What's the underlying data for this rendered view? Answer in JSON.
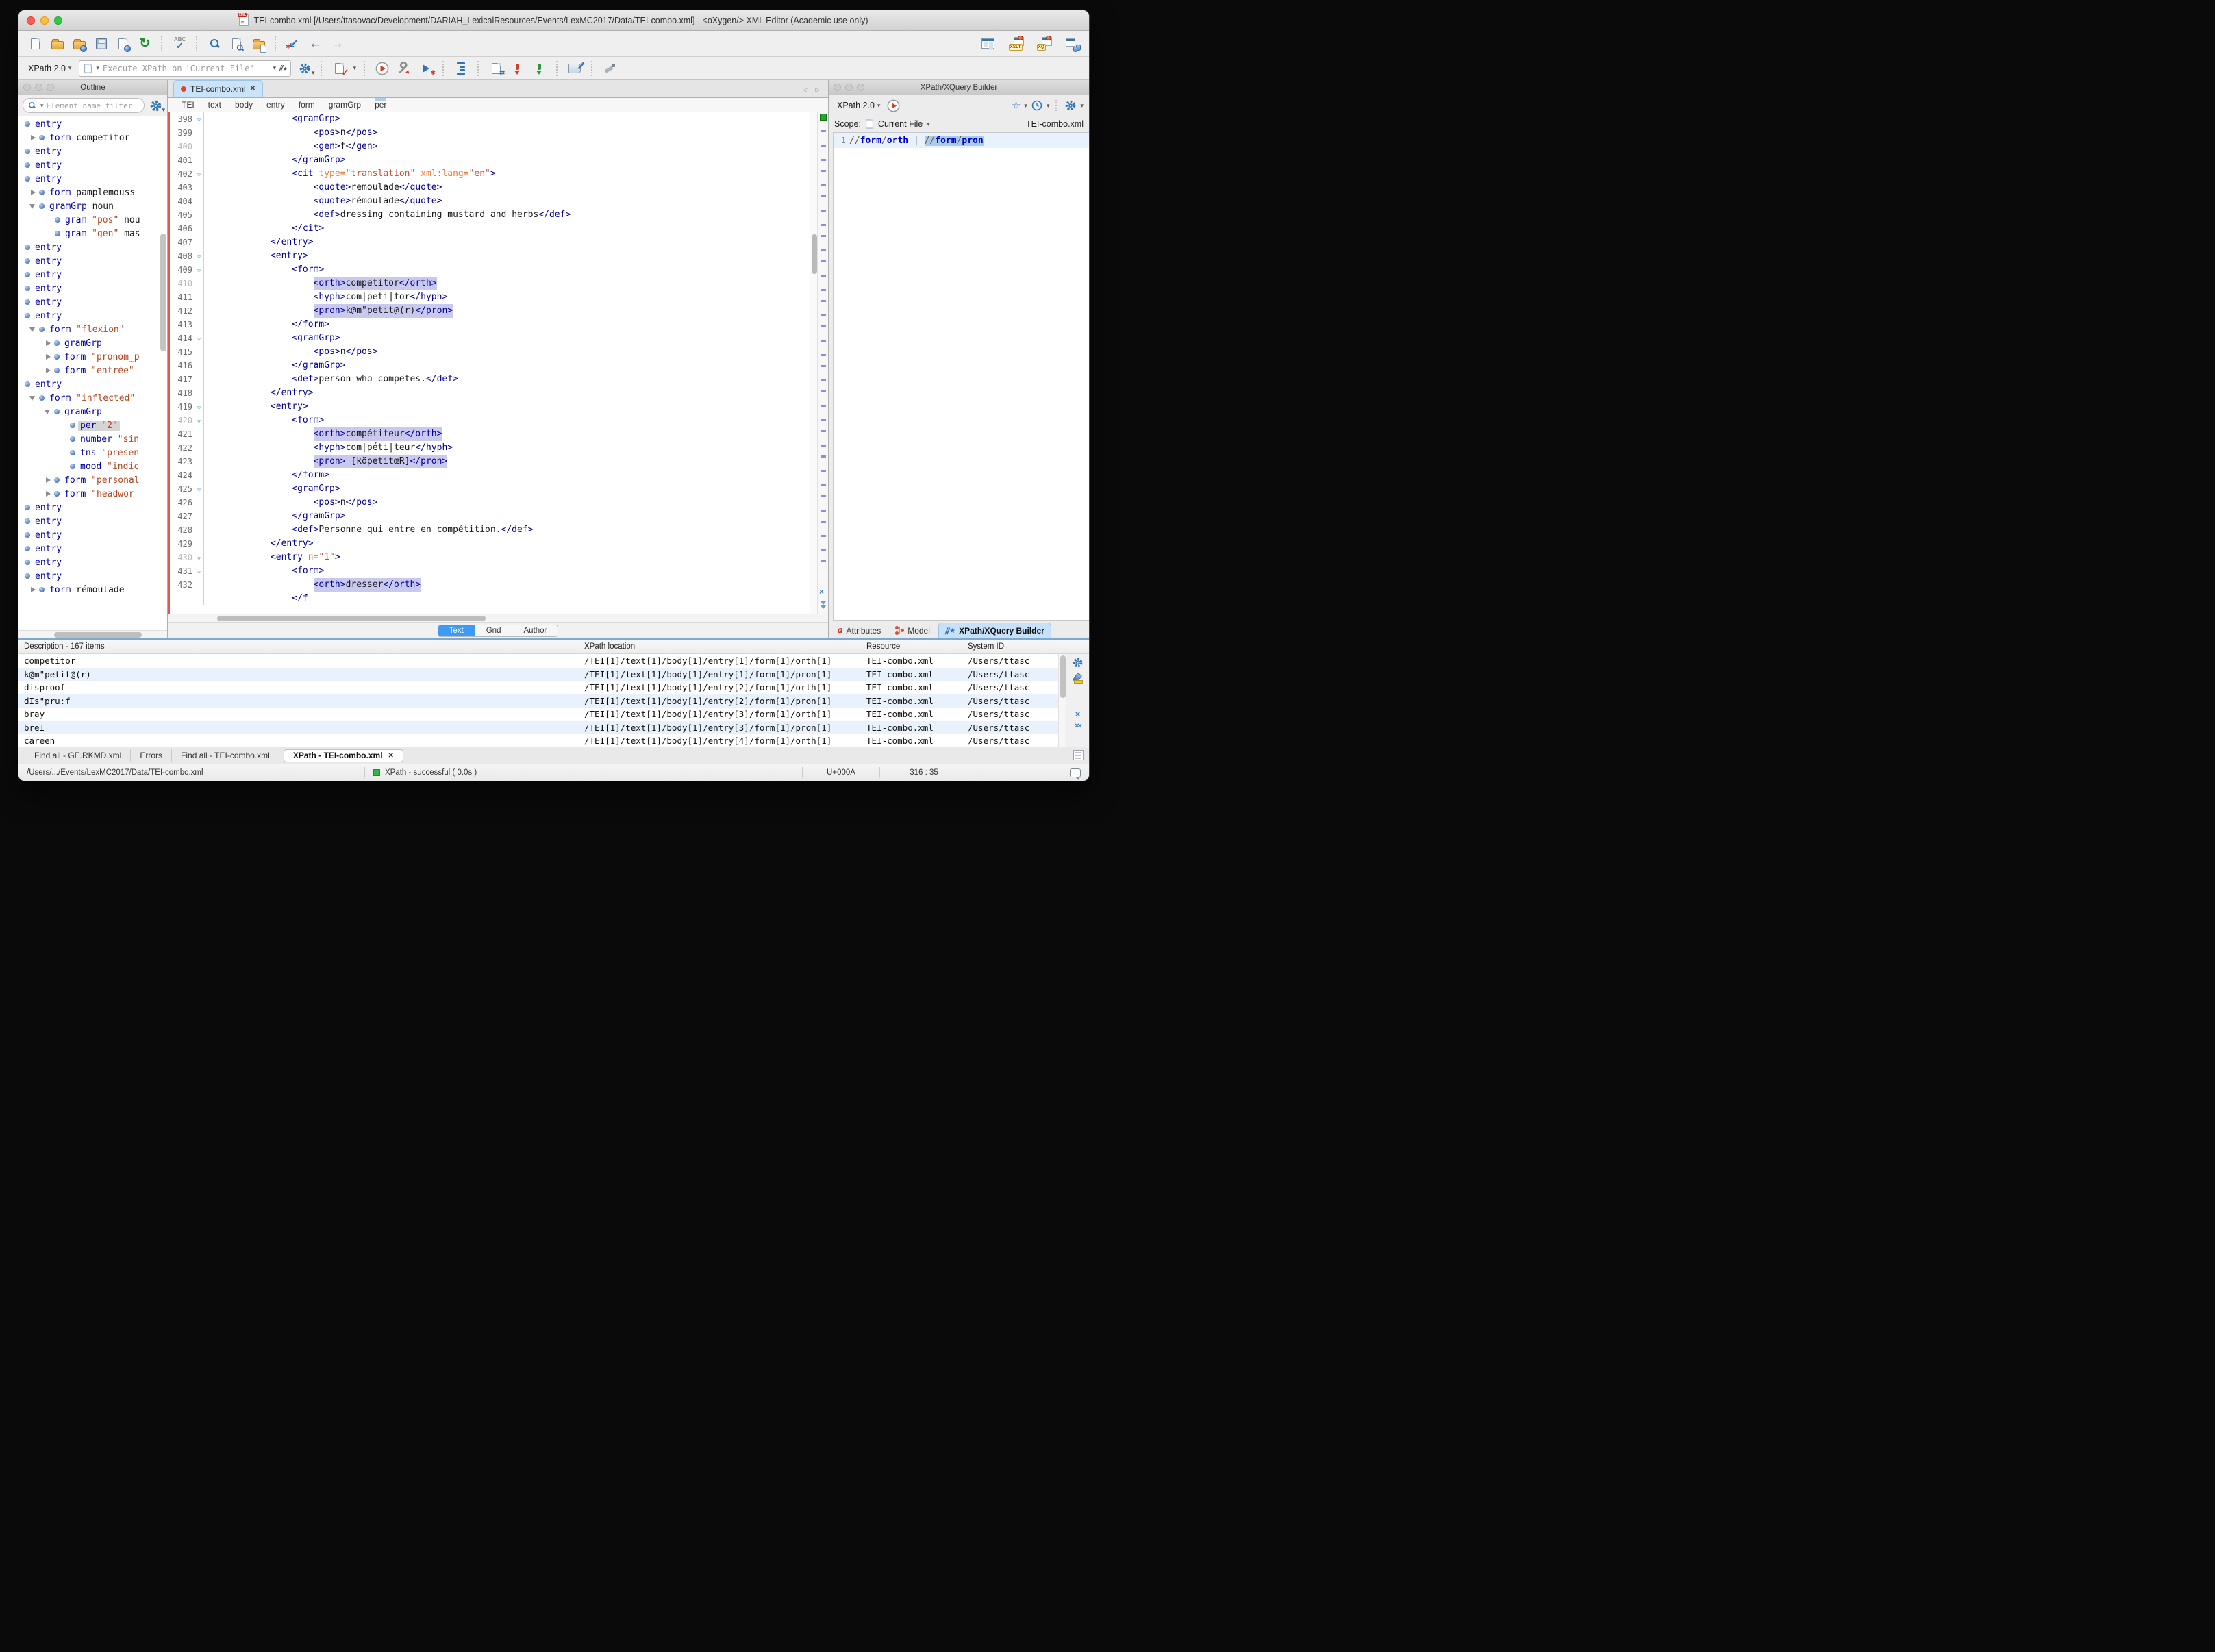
{
  "window": {
    "title": "TEI-combo.xml [/Users/ttasovac/Development/DARIAH_LexicalResources/Events/LexMC2017/Data/TEI-combo.xml] - <oXygen/> XML Editor (Academic use only)"
  },
  "icons": {
    "fold": "▽",
    "reload": "↻",
    "spell_abc": "ABC",
    "check": "✓",
    "last_edit": "↙",
    "asterisk": "✱",
    "back": "←",
    "forward": "→",
    "xslt_badge": "XSLT",
    "xq_badge": "XQ",
    "dropdown": "▾",
    "star": "☆",
    "fav_star": "★",
    "slashes": "//",
    "tab_nav": "◁ ▷",
    "close": "✕",
    "clear": "×",
    "clear_all": "××",
    "attr_a": "a"
  },
  "toolbar_xpath": {
    "engine": "XPath 2.0",
    "execute_label": "Execute XPath on",
    "execute_target": "'Current File'"
  },
  "outline": {
    "title": "Outline",
    "filter_placeholder": "Element name filter",
    "items": [
      {
        "l": 1,
        "n": "entry"
      },
      {
        "l": 2,
        "e": "r",
        "n": "form",
        "t": "competitor"
      },
      {
        "l": 1,
        "n": "entry"
      },
      {
        "l": 1,
        "n": "entry"
      },
      {
        "l": 1,
        "n": "entry"
      },
      {
        "l": 2,
        "e": "r",
        "n": "form",
        "t": "pamplemouss"
      },
      {
        "l": 2,
        "e": "d",
        "n": "gramGrp",
        "t": "noun"
      },
      {
        "l": 3,
        "n": "gram",
        "v": "\"pos\"",
        "t": "nou"
      },
      {
        "l": 3,
        "n": "gram",
        "v": "\"gen\"",
        "t": "mas"
      },
      {
        "l": 1,
        "n": "entry"
      },
      {
        "l": 1,
        "n": "entry"
      },
      {
        "l": 1,
        "n": "entry"
      },
      {
        "l": 1,
        "n": "entry"
      },
      {
        "l": 1,
        "n": "entry"
      },
      {
        "l": 1,
        "n": "entry"
      },
      {
        "l": 2,
        "e": "d",
        "n": "form",
        "v": "\"flexion\""
      },
      {
        "l": 3,
        "e": "r",
        "n": "gramGrp"
      },
      {
        "l": 3,
        "e": "r",
        "n": "form",
        "v": "\"pronom_p"
      },
      {
        "l": 3,
        "e": "r",
        "n": "form",
        "v": "\"entrée\""
      },
      {
        "l": 1,
        "n": "entry"
      },
      {
        "l": 2,
        "e": "d",
        "n": "form",
        "v": "\"inflected\""
      },
      {
        "l": 3,
        "e": "d",
        "n": "gramGrp"
      },
      {
        "l": 4,
        "n": "per",
        "v": "\"2\"",
        "sel": true
      },
      {
        "l": 4,
        "n": "number",
        "v": "\"sin"
      },
      {
        "l": 4,
        "n": "tns",
        "v": "\"presen"
      },
      {
        "l": 4,
        "n": "mood",
        "v": "\"indic"
      },
      {
        "l": 3,
        "e": "r",
        "n": "form",
        "v": "\"personal"
      },
      {
        "l": 3,
        "e": "r",
        "n": "form",
        "v": "\"headwor"
      },
      {
        "l": 1,
        "n": "entry"
      },
      {
        "l": 1,
        "n": "entry"
      },
      {
        "l": 1,
        "n": "entry"
      },
      {
        "l": 1,
        "n": "entry"
      },
      {
        "l": 1,
        "n": "entry"
      },
      {
        "l": 1,
        "n": "entry"
      },
      {
        "l": 2,
        "e": "r",
        "n": "form",
        "t": "rémoulade"
      }
    ]
  },
  "editor": {
    "tab_title": "TEI-combo.xml",
    "breadcrumb": [
      "TEI",
      "text",
      "body",
      "entry",
      "form",
      "gramGrp",
      "per"
    ],
    "modes": [
      "Text",
      "Grid",
      "Author"
    ],
    "active_mode": "Text",
    "lines": [
      {
        "n": "398",
        "fold": true,
        "ind": 16,
        "seg": [
          [
            "g",
            "<gramGrp>"
          ]
        ]
      },
      {
        "n": "399",
        "ind": 20,
        "seg": [
          [
            "g",
            "<pos>"
          ],
          [
            "x",
            "n"
          ],
          [
            "g",
            "</pos>"
          ]
        ]
      },
      {
        "n": "400",
        "dim": true,
        "ind": 20,
        "seg": [
          [
            "g",
            "<gen>"
          ],
          [
            "x",
            "f"
          ],
          [
            "g",
            "</gen>"
          ]
        ]
      },
      {
        "n": "401",
        "ind": 16,
        "seg": [
          [
            "g",
            "</gramGrp>"
          ]
        ]
      },
      {
        "n": "402",
        "fold": true,
        "ind": 16,
        "seg": [
          [
            "g",
            "<cit"
          ],
          [
            "a",
            " type="
          ],
          [
            "v",
            "\"translation\""
          ],
          [
            "a",
            " xml:lang="
          ],
          [
            "v",
            "\"en\""
          ],
          [
            "g",
            ">"
          ]
        ]
      },
      {
        "n": "403",
        "ind": 20,
        "seg": [
          [
            "g",
            "<quote>"
          ],
          [
            "x",
            "remoulade"
          ],
          [
            "g",
            "</quote>"
          ]
        ]
      },
      {
        "n": "404",
        "ind": 20,
        "seg": [
          [
            "g",
            "<quote>"
          ],
          [
            "x",
            "rémoulade"
          ],
          [
            "g",
            "</quote>"
          ]
        ]
      },
      {
        "n": "405",
        "ind": 20,
        "seg": [
          [
            "g",
            "<def>"
          ],
          [
            "x",
            "dressing containing mustard and herbs"
          ],
          [
            "g",
            "</def>"
          ]
        ]
      },
      {
        "n": "406",
        "ind": 16,
        "seg": [
          [
            "g",
            "</cit>"
          ]
        ]
      },
      {
        "n": "407",
        "ind": 12,
        "seg": [
          [
            "g",
            "</entry>"
          ]
        ]
      },
      {
        "n": "408",
        "fold": true,
        "ind": 12,
        "seg": [
          [
            "g",
            "<entry>"
          ]
        ]
      },
      {
        "n": "409",
        "fold": true,
        "ind": 16,
        "seg": [
          [
            "g",
            "<form>"
          ]
        ]
      },
      {
        "n": "410",
        "dim": true,
        "ind": 20,
        "hl": true,
        "seg": [
          [
            "g",
            "<orth>"
          ],
          [
            "x",
            "competitor"
          ],
          [
            "g",
            "</orth>"
          ]
        ]
      },
      {
        "n": "411",
        "ind": 20,
        "seg": [
          [
            "g",
            "<hyph>"
          ],
          [
            "x",
            "com|peti|tor"
          ],
          [
            "g",
            "</hyph>"
          ]
        ]
      },
      {
        "n": "412",
        "ind": 20,
        "hl": true,
        "seg": [
          [
            "g",
            "<pron>"
          ],
          [
            "x",
            "k@m\"petit@(r)"
          ],
          [
            "g",
            "</pron>"
          ]
        ]
      },
      {
        "n": "413",
        "ind": 16,
        "seg": [
          [
            "g",
            "</form>"
          ]
        ]
      },
      {
        "n": "414",
        "fold": true,
        "ind": 16,
        "seg": [
          [
            "g",
            "<gramGrp>"
          ]
        ]
      },
      {
        "n": "415",
        "ind": 20,
        "seg": [
          [
            "g",
            "<pos>"
          ],
          [
            "x",
            "n"
          ],
          [
            "g",
            "</pos>"
          ]
        ]
      },
      {
        "n": "416",
        "ind": 16,
        "seg": [
          [
            "g",
            "</gramGrp>"
          ]
        ]
      },
      {
        "n": "417",
        "ind": 16,
        "seg": [
          [
            "g",
            "<def>"
          ],
          [
            "x",
            "person who competes."
          ],
          [
            "g",
            "</def>"
          ]
        ]
      },
      {
        "n": "418",
        "ind": 12,
        "seg": [
          [
            "g",
            "</entry>"
          ]
        ]
      },
      {
        "n": "419",
        "fold": true,
        "ind": 12,
        "seg": [
          [
            "g",
            "<entry>"
          ]
        ]
      },
      {
        "n": "420",
        "dim": true,
        "fold": true,
        "ind": 16,
        "seg": [
          [
            "g",
            "<form>"
          ]
        ]
      },
      {
        "n": "421",
        "ind": 20,
        "hl": true,
        "seg": [
          [
            "g",
            "<orth>"
          ],
          [
            "x",
            "compétiteur"
          ],
          [
            "g",
            "</orth>"
          ]
        ]
      },
      {
        "n": "422",
        "ind": 20,
        "seg": [
          [
            "g",
            "<hyph>"
          ],
          [
            "x",
            "com|péti|teur"
          ],
          [
            "g",
            "</hyph>"
          ]
        ]
      },
      {
        "n": "423",
        "ind": 20,
        "hl": true,
        "seg": [
          [
            "g",
            "<pron>"
          ],
          [
            "x",
            " [köpetitœR]"
          ],
          [
            "g",
            "</pron>"
          ]
        ]
      },
      {
        "n": "424",
        "ind": 16,
        "seg": [
          [
            "g",
            "</form>"
          ]
        ]
      },
      {
        "n": "425",
        "fold": true,
        "ind": 16,
        "seg": [
          [
            "g",
            "<gramGrp>"
          ]
        ]
      },
      {
        "n": "426",
        "ind": 20,
        "seg": [
          [
            "g",
            "<pos>"
          ],
          [
            "x",
            "n"
          ],
          [
            "g",
            "</pos>"
          ]
        ]
      },
      {
        "n": "427",
        "ind": 16,
        "seg": [
          [
            "g",
            "</gramGrp>"
          ]
        ]
      },
      {
        "n": "428",
        "ind": 16,
        "seg": [
          [
            "g",
            "<def>"
          ],
          [
            "x",
            "Personne qui entre en compétition."
          ],
          [
            "g",
            "</def>"
          ]
        ]
      },
      {
        "n": "429",
        "ind": 12,
        "seg": [
          [
            "g",
            "</entry>"
          ]
        ]
      },
      {
        "n": "430",
        "dim": true,
        "fold": true,
        "ind": 12,
        "seg": [
          [
            "g",
            "<entry"
          ],
          [
            "a",
            " n="
          ],
          [
            "v",
            "\"1\""
          ],
          [
            "g",
            ">"
          ]
        ]
      },
      {
        "n": "431",
        "fold": true,
        "ind": 16,
        "seg": [
          [
            "g",
            "<form>"
          ]
        ]
      },
      {
        "n": "432",
        "ind": 20,
        "hl": true,
        "seg": [
          [
            "g",
            "<orth>"
          ],
          [
            "x",
            "dresser"
          ],
          [
            "g",
            "</orth>"
          ]
        ]
      },
      {
        "n": "",
        "ind": 16,
        "seg": [
          [
            "g",
            "</f"
          ]
        ]
      }
    ]
  },
  "builder": {
    "title": "XPath/XQuery Builder",
    "engine": "XPath 2.0",
    "scope_label": "Scope:",
    "scope_value": "Current File",
    "scope_file": "TEI-combo.xml",
    "line_number": "1",
    "expression": [
      {
        "c": "op",
        "t": "//"
      },
      {
        "c": "el",
        "t": "form"
      },
      {
        "c": "op",
        "t": "/"
      },
      {
        "c": "el",
        "t": "orth"
      },
      {
        "c": "op",
        "t": " | "
      },
      {
        "c": "op",
        "t": "//",
        "s": true
      },
      {
        "c": "el",
        "t": "form",
        "s": true
      },
      {
        "c": "op",
        "t": "/",
        "s": true
      },
      {
        "c": "el",
        "t": "pron",
        "s": true
      }
    ],
    "tabs": [
      {
        "label": "Attributes"
      },
      {
        "label": "Model"
      },
      {
        "label": "XPath/XQuery Builder",
        "active": true
      }
    ]
  },
  "results": {
    "columns": [
      "Description - 167 items",
      "XPath location",
      "Resource",
      "System ID"
    ],
    "rows": [
      [
        "competitor",
        "/TEI[1]/text[1]/body[1]/entry[1]/form[1]/orth[1]",
        "TEI-combo.xml",
        "/Users/ttasc"
      ],
      [
        "k@m\"petit@(r)",
        "/TEI[1]/text[1]/body[1]/entry[1]/form[1]/pron[1]",
        "TEI-combo.xml",
        "/Users/ttasc"
      ],
      [
        "disproof",
        "/TEI[1]/text[1]/body[1]/entry[2]/form[1]/orth[1]",
        "TEI-combo.xml",
        "/Users/ttasc"
      ],
      [
        "dIs\"pru:f",
        "/TEI[1]/text[1]/body[1]/entry[2]/form[1]/pron[1]",
        "TEI-combo.xml",
        "/Users/ttasc"
      ],
      [
        "bray",
        "/TEI[1]/text[1]/body[1]/entry[3]/form[1]/orth[1]",
        "TEI-combo.xml",
        "/Users/ttasc"
      ],
      [
        "breI",
        "/TEI[1]/text[1]/body[1]/entry[3]/form[1]/pron[1]",
        "TEI-combo.xml",
        "/Users/ttasc"
      ],
      [
        "careen",
        "/TEI[1]/text[1]/body[1]/entry[4]/form[1]/orth[1]",
        "TEI-combo.xml",
        "/Users/ttasc"
      ]
    ]
  },
  "bottom_tabs": [
    {
      "label": "Find all - GE.RKMD.xml"
    },
    {
      "label": "Errors"
    },
    {
      "label": "Find all - TEI-combo.xml"
    },
    {
      "label": "XPath - TEI-combo.xml",
      "active": true
    }
  ],
  "status": {
    "path": "/Users/.../Events/LexMC2017/Data/TEI-combo.xml",
    "message": "XPath - successful  ( 0.0s )",
    "unicode": "U+000A",
    "position": "316 : 35"
  }
}
